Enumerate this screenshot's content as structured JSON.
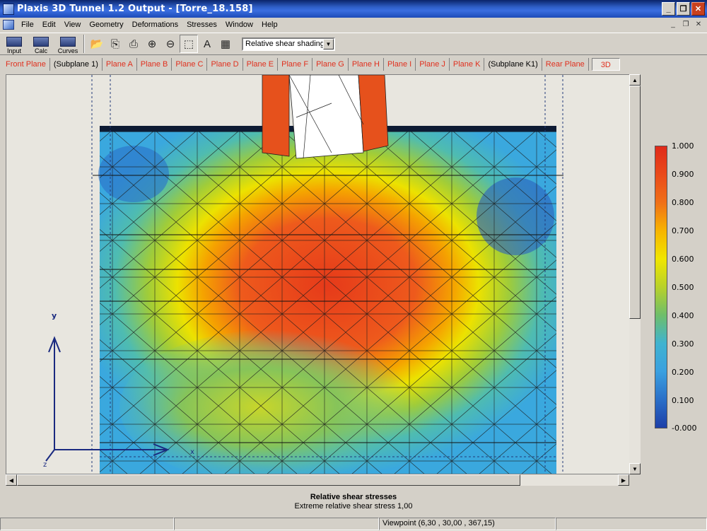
{
  "window": {
    "title": "Plaxis 3D Tunnel 1.2 Output - [Torre_18.158]"
  },
  "menu": {
    "items": [
      {
        "label": "File",
        "key": "F"
      },
      {
        "label": "Edit",
        "key": "E"
      },
      {
        "label": "View",
        "key": "V"
      },
      {
        "label": "Geometry",
        "key": "G"
      },
      {
        "label": "Deformations",
        "key": "D"
      },
      {
        "label": "Stresses",
        "key": "S"
      },
      {
        "label": "Window",
        "key": "W"
      },
      {
        "label": "Help",
        "key": "H"
      }
    ]
  },
  "toolbar": {
    "input_label": "Input",
    "calc_label": "Calc",
    "curves_label": "Curves",
    "result_type": "Relative shear shadings"
  },
  "tabs": [
    {
      "label": "Front Plane"
    },
    {
      "label": "(Subplane 1)"
    },
    {
      "label": "Plane A"
    },
    {
      "label": "Plane B"
    },
    {
      "label": "Plane C"
    },
    {
      "label": "Plane D"
    },
    {
      "label": "Plane E"
    },
    {
      "label": "Plane F"
    },
    {
      "label": "Plane G"
    },
    {
      "label": "Plane H"
    },
    {
      "label": "Plane I"
    },
    {
      "label": "Plane J"
    },
    {
      "label": "Plane K"
    },
    {
      "label": "(Subplane K1)"
    },
    {
      "label": "Rear Plane"
    },
    {
      "label": "3D"
    }
  ],
  "axes": {
    "y": "y",
    "x": "x",
    "z": "z"
  },
  "legend": {
    "labels": [
      "1.000",
      "0.900",
      "0.800",
      "0.700",
      "0.600",
      "0.500",
      "0.400",
      "0.300",
      "0.200",
      "0.100",
      "-0.000"
    ]
  },
  "footer": {
    "caption": "Relative shear stresses",
    "subcaption": "Extreme relative shear stress 1,00"
  },
  "status": {
    "viewpoint": "Viewpoint (6,30 , 30,00 , 367,15)"
  },
  "colors": {
    "max": "#e02a1a",
    "mid": "#f0e600",
    "min": "#1d3fa8"
  }
}
